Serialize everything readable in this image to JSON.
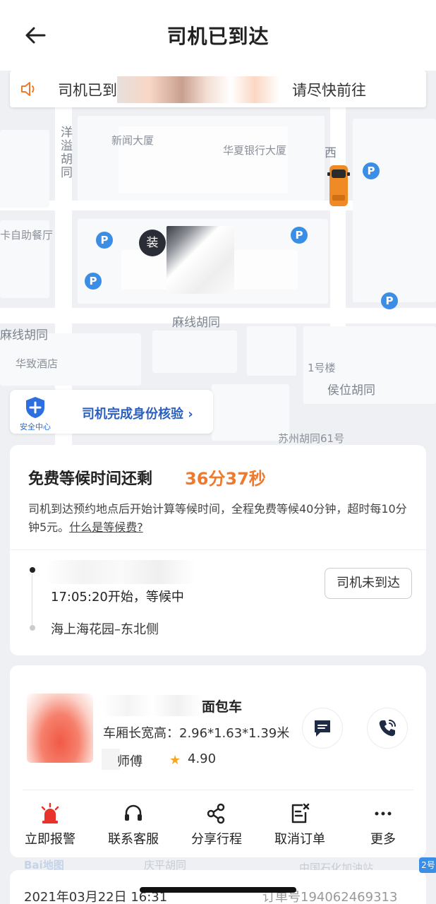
{
  "header": {
    "title": "司机已到达"
  },
  "notice": {
    "prefix": "司机已到",
    "suffix": "请尽快前往"
  },
  "map": {
    "labels": {
      "yangyi": "洋溢胡同",
      "xinwen": "新闻大厦",
      "huaxia": "华夏银行大厦",
      "xi": "西",
      "buffet": "卡自助餐厅",
      "maxian": "麻线胡同",
      "maxian_left": "麻线胡同",
      "huazhi": "华致酒店",
      "building1": "1号楼",
      "houwei": "侯位胡同",
      "suzhou": "苏州胡同61号",
      "qingping": "庆平胡同",
      "sinopec": "中国石化加油站",
      "baidu": "Bai地图"
    },
    "poi_char": "装",
    "parking": "P"
  },
  "safety": {
    "badge_label": "安全中心",
    "text": "司机完成身份核验",
    "chevron": "›"
  },
  "wait": {
    "title": "免费等候时间还剩",
    "countdown": "36分37秒",
    "desc": "司机到达预约地点后开始计算等候时间，全程免费等候40分钟，超时每10分钟5元。",
    "link": "什么是等候费?",
    "start": "17:05:20开始，等候中",
    "address": "海上海花园–东北侧",
    "no_arrive_btn": "司机未到达"
  },
  "driver": {
    "vehicle_type": "面包车",
    "dims": "车厢长宽高：2.96*1.63*1.39米",
    "master": "师傅",
    "rating": "4.90"
  },
  "actions": [
    {
      "label": "立即报警",
      "icon": "alarm-icon"
    },
    {
      "label": "联系客服",
      "icon": "headset-icon"
    },
    {
      "label": "分享行程",
      "icon": "share-icon"
    },
    {
      "label": "取消订单",
      "icon": "cancel-order-icon"
    },
    {
      "label": "更多",
      "icon": "more-icon"
    }
  ],
  "order": {
    "date": "2021年03月22日 16:31",
    "number": "订单号194062469313"
  },
  "map_badge": "2号",
  "colors": {
    "accent": "#f07a2c",
    "link_blue": "#2b5fbf",
    "parking_blue": "#3a8ee6",
    "alarm_red": "#e8332a"
  }
}
